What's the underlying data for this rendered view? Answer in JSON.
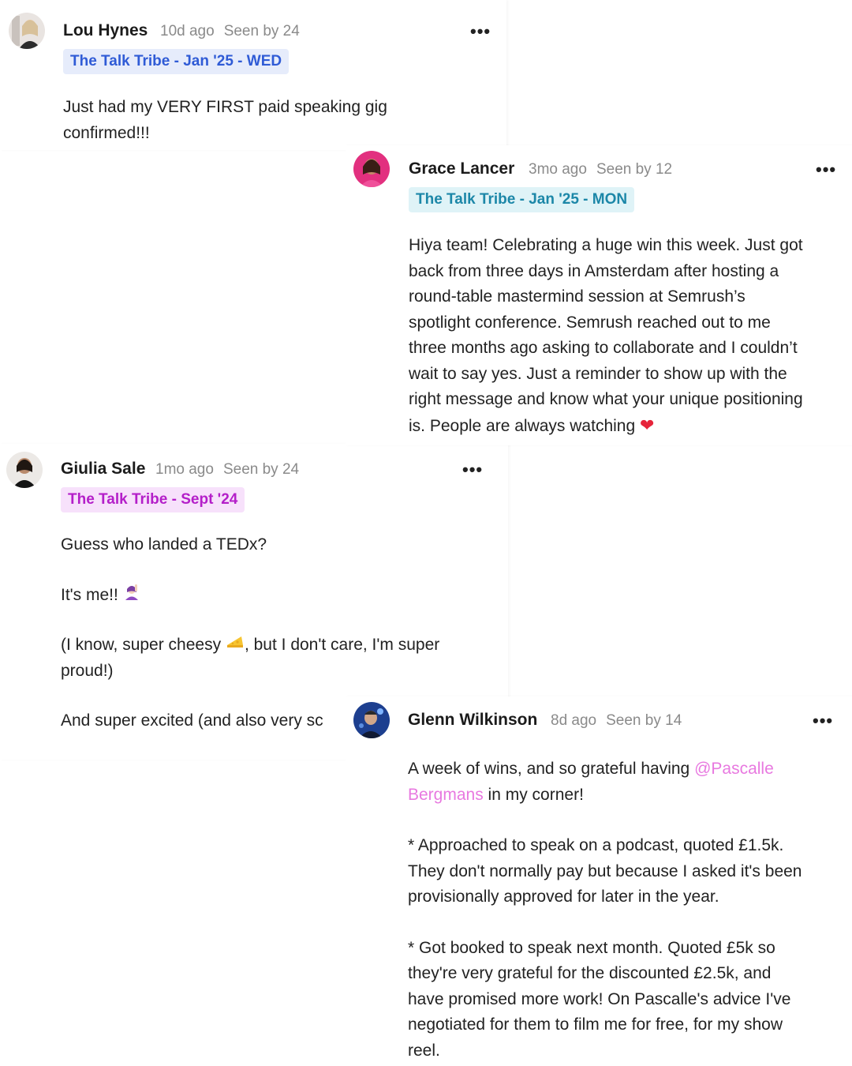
{
  "posts": [
    {
      "author": "Lou Hynes",
      "time": "10d ago",
      "seen": "Seen by 24",
      "more_label": "•••",
      "tag": "The Talk Tribe - Jan '25 - WED",
      "tag_color": "#2f5bd6",
      "tag_bg": "#e6ecfb",
      "text": [
        "Just had my VERY FIRST paid speaking gig",
        "confirmed!!!"
      ]
    },
    {
      "author": "Grace Lancer",
      "time": "3mo ago",
      "seen": "Seen by 12",
      "more_label": "•••",
      "tag": "The Talk Tribe - Jan '25 - MON",
      "tag_color": "#1c87a8",
      "tag_bg": "#dff3f7",
      "text": [
        "Hiya team! Celebrating a huge win this week. Just got",
        "back from three days in Amsterdam after hosting a",
        "round-table mastermind session at Semrush’s",
        "spotlight conference. Semrush reached out to me",
        "three months ago asking to collaborate and I couldn’t",
        "wait to say yes. Just a reminder to show up with the",
        "right message and know what your unique positioning",
        "is. People are always watching"
      ],
      "end_emoji": "heart-emoji"
    },
    {
      "author": "Giulia Sale",
      "time": "1mo ago",
      "seen": "Seen by 24",
      "more_label": "•••",
      "tag": "The Talk Tribe - Sept '24",
      "tag_color": "#b41fc9",
      "tag_bg": "#f7e1fb",
      "text_1": "Guess who landed a TEDx?",
      "text_2": "It's me!!",
      "text_3a": "(I know, super cheesy",
      "text_3b": ", but I don't care, I'm super",
      "text_3c": "proud!)",
      "text_4": "And super excited (and also very sc"
    },
    {
      "author": "Glenn Wilkinson",
      "time": "8d ago",
      "seen": "Seen by 14",
      "more_label": "•••",
      "text_1a": "A week of wins, and so grateful having ",
      "mention_1": "@Pascalle",
      "mention_2": "Bergmans",
      "text_1b": " in my corner!",
      "bullet_1": [
        "* Approached to speak on a podcast, quoted £1.5k.",
        "They don't normally pay but because I asked it's been",
        "provisionally approved for later in the year."
      ],
      "bullet_2": [
        "* Got booked to speak next month. Quoted £5k so",
        "they're very grateful for the discounted £2.5k, and",
        "have promised more work! On Pascalle's advice I've",
        "negotiated for them to film me for free, for my show",
        "reel."
      ]
    }
  ]
}
